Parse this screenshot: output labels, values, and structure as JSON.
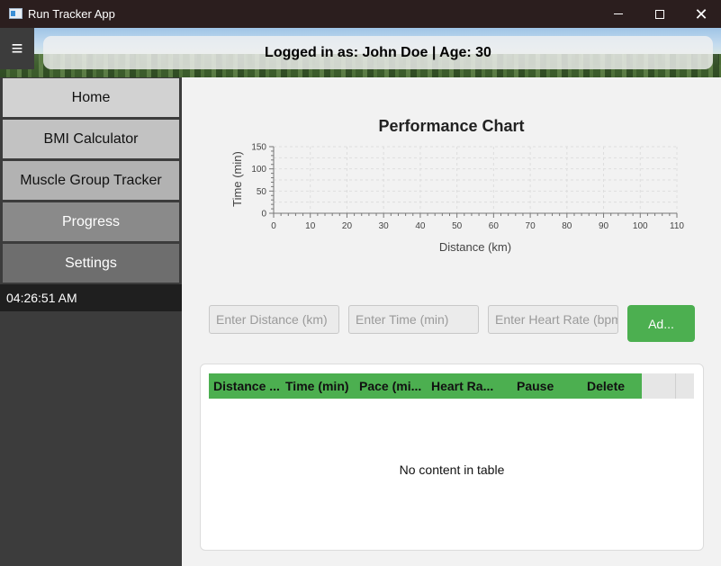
{
  "window": {
    "title": "Run Tracker App",
    "close_glyph": "✕"
  },
  "header": {
    "menu_glyph": "≡",
    "login_text": "Logged in as: John Doe | Age: 30"
  },
  "sidebar": {
    "items": [
      {
        "label": "Home"
      },
      {
        "label": "BMI Calculator"
      },
      {
        "label": "Muscle Group Tracker"
      },
      {
        "label": "Progress"
      },
      {
        "label": "Settings"
      }
    ],
    "clock": "04:26:51 AM"
  },
  "form": {
    "distance_placeholder": "Enter Distance (km)",
    "time_placeholder": "Enter Time (min)",
    "heart_rate_placeholder": "Enter Heart Rate (bpm)",
    "add_label": "Ad..."
  },
  "table": {
    "headers": [
      "Distance ...",
      "Time (min)",
      "Pace (mi...",
      "Heart Ra...",
      "Pause",
      "Delete"
    ],
    "empty_text": "No content in table"
  },
  "colors": {
    "accent_green": "#4caf50",
    "sidebar_bg": "#3c3c3c"
  },
  "chart_data": {
    "type": "line",
    "title": "Performance Chart",
    "xlabel": "Distance (km)",
    "ylabel": "Time (min)",
    "xlim": [
      0,
      110
    ],
    "ylim": [
      0,
      150
    ],
    "x_ticks": [
      0,
      10,
      20,
      30,
      40,
      50,
      60,
      70,
      80,
      90,
      100,
      110
    ],
    "y_ticks": [
      0,
      50,
      100,
      150
    ],
    "grid": true,
    "series": []
  }
}
